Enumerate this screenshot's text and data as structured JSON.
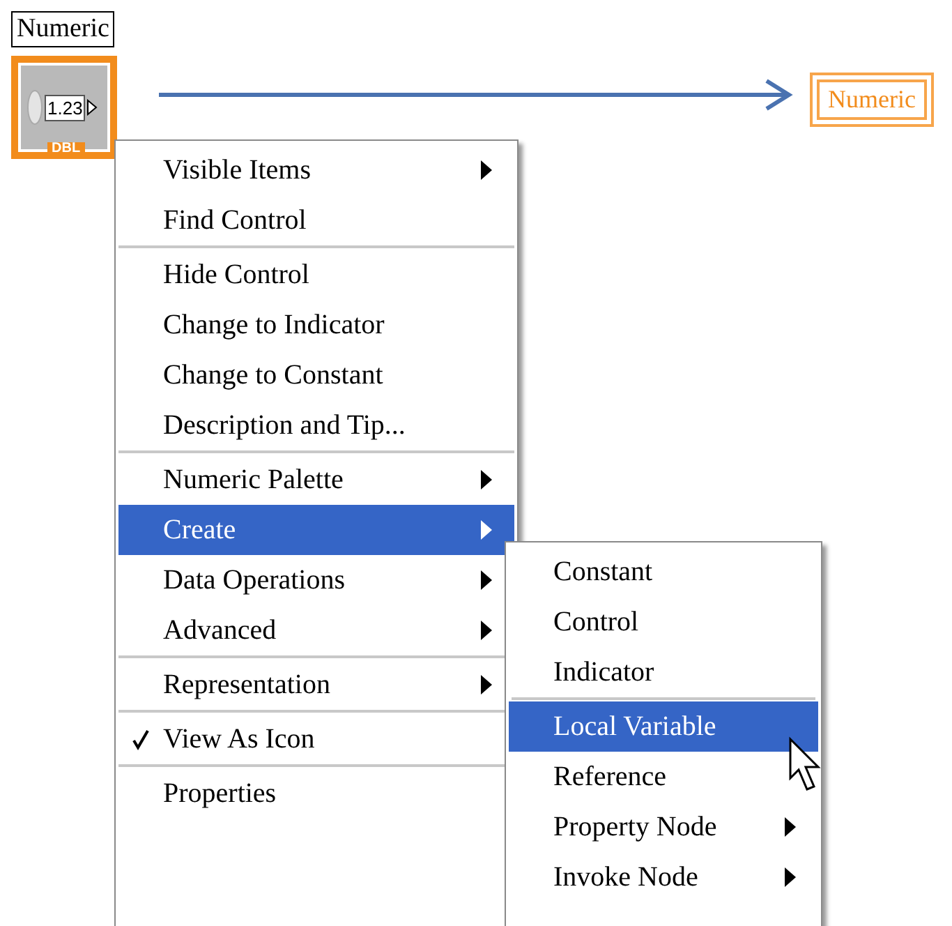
{
  "control": {
    "label": "Numeric",
    "value": "1.23",
    "type": "DBL"
  },
  "indicator": {
    "label": "Numeric"
  },
  "context_menu": {
    "items": [
      {
        "kind": "item",
        "label": "Visible Items",
        "submenu": true,
        "selected": false,
        "checked": false
      },
      {
        "kind": "item",
        "label": "Find Control",
        "submenu": false,
        "selected": false,
        "checked": false
      },
      {
        "kind": "separator"
      },
      {
        "kind": "item",
        "label": "Hide Control",
        "submenu": false,
        "selected": false,
        "checked": false
      },
      {
        "kind": "item",
        "label": "Change to Indicator",
        "submenu": false,
        "selected": false,
        "checked": false
      },
      {
        "kind": "item",
        "label": "Change to Constant",
        "submenu": false,
        "selected": false,
        "checked": false
      },
      {
        "kind": "item",
        "label": "Description and Tip...",
        "submenu": false,
        "selected": false,
        "checked": false
      },
      {
        "kind": "separator"
      },
      {
        "kind": "item",
        "label": "Numeric Palette",
        "submenu": true,
        "selected": false,
        "checked": false
      },
      {
        "kind": "item",
        "label": "Create",
        "submenu": true,
        "selected": true,
        "checked": false
      },
      {
        "kind": "item",
        "label": "Data Operations",
        "submenu": true,
        "selected": false,
        "checked": false
      },
      {
        "kind": "item",
        "label": "Advanced",
        "submenu": true,
        "selected": false,
        "checked": false
      },
      {
        "kind": "separator"
      },
      {
        "kind": "item",
        "label": "Representation",
        "submenu": true,
        "selected": false,
        "checked": false
      },
      {
        "kind": "separator"
      },
      {
        "kind": "item",
        "label": "View As Icon",
        "submenu": false,
        "selected": false,
        "checked": true
      },
      {
        "kind": "separator"
      },
      {
        "kind": "item",
        "label": "Properties",
        "submenu": false,
        "selected": false,
        "checked": false
      }
    ]
  },
  "create_submenu": {
    "items": [
      {
        "kind": "item",
        "label": "Constant",
        "submenu": false,
        "selected": false,
        "checked": false
      },
      {
        "kind": "item",
        "label": "Control",
        "submenu": false,
        "selected": false,
        "checked": false
      },
      {
        "kind": "item",
        "label": "Indicator",
        "submenu": false,
        "selected": false,
        "checked": false
      },
      {
        "kind": "separator"
      },
      {
        "kind": "item",
        "label": "Local Variable",
        "submenu": false,
        "selected": true,
        "checked": false
      },
      {
        "kind": "item",
        "label": "Reference",
        "submenu": false,
        "selected": false,
        "checked": false
      },
      {
        "kind": "item",
        "label": "Property Node",
        "submenu": true,
        "selected": false,
        "checked": false
      },
      {
        "kind": "item",
        "label": "Invoke Node",
        "submenu": true,
        "selected": false,
        "checked": false
      }
    ]
  }
}
